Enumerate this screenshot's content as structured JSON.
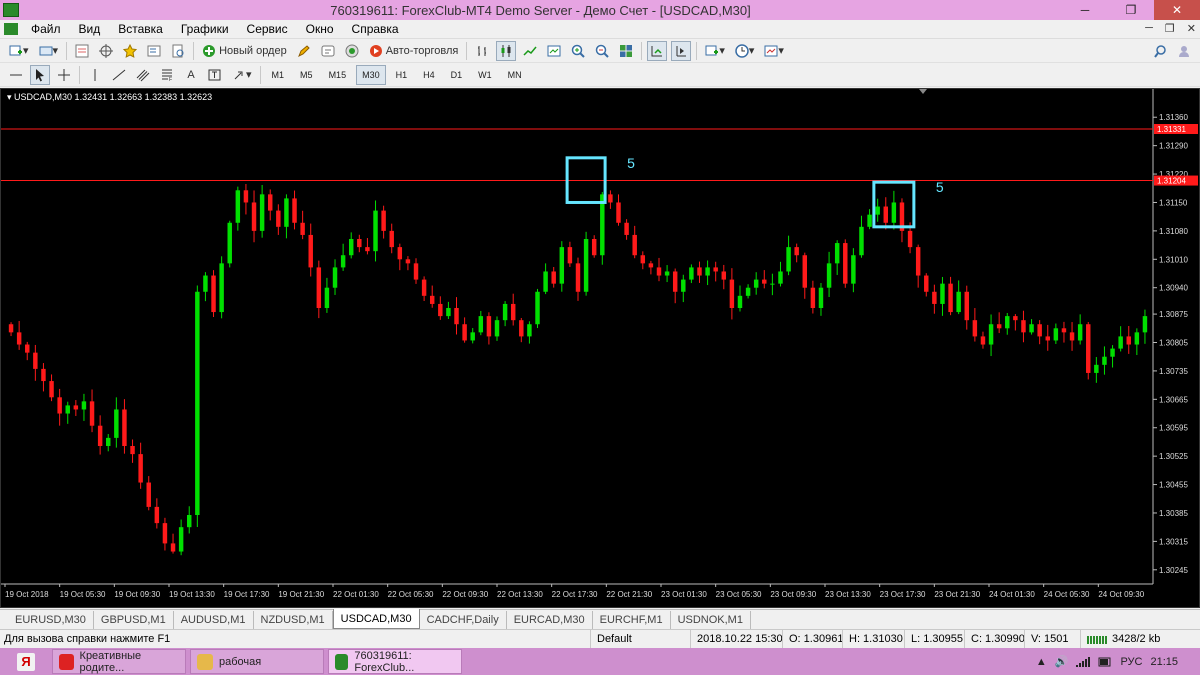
{
  "window": {
    "title": "760319611: ForexClub-MT4 Demo Server - Демо Счет - [USDCAD,M30]",
    "minimize_label": "─",
    "maximize_label": "❐",
    "close_label": "✕"
  },
  "menu": {
    "items": [
      "Файл",
      "Вид",
      "Вставка",
      "Графики",
      "Сервис",
      "Окно",
      "Справка"
    ],
    "mdi_controls": [
      "─",
      "❐",
      "✕"
    ]
  },
  "toolbar1": {
    "new_order_label": "Новый ордер",
    "auto_trading_label": "Авто-торговля"
  },
  "toolbar2": {
    "timeframes": [
      "M1",
      "M5",
      "M15",
      "M30",
      "H1",
      "H4",
      "D1",
      "W1",
      "MN"
    ],
    "active_timeframe": "M30",
    "text_tool_label": "A"
  },
  "chart": {
    "header": "USDCAD,M30  1.32431 1.32663 1.32383 1.32623",
    "background": "#000000",
    "bull_color": "#00e000",
    "bear_color": "#ff1a1a",
    "level_color": "#ff1a1a",
    "box_color": "#66e6ff",
    "annotation_color": "#66e6ff"
  },
  "chart_data": {
    "type": "candlestick",
    "symbol": "USDCAD",
    "timeframe": "M30",
    "ylim": [
      1.3021,
      1.314
    ],
    "y_ticks": [
      "1.31360",
      "1.31290",
      "1.31220",
      "1.31150",
      "1.31080",
      "1.31010",
      "1.30940",
      "1.30875",
      "1.30805",
      "1.30735",
      "1.30665",
      "1.30595",
      "1.30525",
      "1.30455",
      "1.30385",
      "1.30315",
      "1.30245"
    ],
    "x_ticks": [
      "19 Oct 2018",
      "19 Oct 05:30",
      "19 Oct 09:30",
      "19 Oct 13:30",
      "19 Oct 17:30",
      "19 Oct 21:30",
      "22 Oct 01:30",
      "22 Oct 05:30",
      "22 Oct 09:30",
      "22 Oct 13:30",
      "22 Oct 17:30",
      "22 Oct 21:30",
      "23 Oct 01:30",
      "23 Oct 05:30",
      "23 Oct 09:30",
      "23 Oct 13:30",
      "23 Oct 17:30",
      "23 Oct 21:30",
      "24 Oct 01:30",
      "24 Oct 05:30",
      "24 Oct 09:30"
    ],
    "horizontal_levels": [
      {
        "value": 1.31331,
        "label": "1.31331"
      },
      {
        "value": 1.31204,
        "label": "1.31204"
      }
    ],
    "annotations": [
      "5",
      "5"
    ],
    "closes": [
      1.3083,
      1.308,
      1.3078,
      1.3074,
      1.3071,
      1.3067,
      1.3063,
      1.3065,
      1.3064,
      1.3066,
      1.306,
      1.3055,
      1.3057,
      1.3064,
      1.3055,
      1.3053,
      1.3046,
      1.304,
      1.3036,
      1.3031,
      1.3029,
      1.3035,
      1.3038,
      1.3093,
      1.3097,
      1.3088,
      1.31,
      1.311,
      1.3118,
      1.3115,
      1.3108,
      1.3117,
      1.3113,
      1.3109,
      1.3116,
      1.311,
      1.3107,
      1.3099,
      1.3089,
      1.3094,
      1.3099,
      1.3102,
      1.3106,
      1.3104,
      1.3103,
      1.3113,
      1.3108,
      1.3104,
      1.3101,
      1.31,
      1.3096,
      1.3092,
      1.309,
      1.3087,
      1.3089,
      1.3085,
      1.3081,
      1.3083,
      1.3087,
      1.3082,
      1.3086,
      1.309,
      1.3086,
      1.3082,
      1.3085,
      1.3093,
      1.3098,
      1.3095,
      1.3104,
      1.31,
      1.3093,
      1.3106,
      1.3102,
      1.3117,
      1.3115,
      1.311,
      1.3107,
      1.3102,
      1.31,
      1.3099,
      1.3097,
      1.3098,
      1.3093,
      1.3096,
      1.3099,
      1.3097,
      1.3099,
      1.3098,
      1.3096,
      1.3089,
      1.3092,
      1.3094,
      1.3096,
      1.3095,
      1.3095,
      1.3098,
      1.3104,
      1.3102,
      1.3094,
      1.3089,
      1.3094,
      1.31,
      1.3105,
      1.3095,
      1.3102,
      1.3109,
      1.3112,
      1.3114,
      1.311,
      1.3115,
      1.3108,
      1.3104,
      1.3097,
      1.3093,
      1.309,
      1.3095,
      1.3088,
      1.3093,
      1.3086,
      1.3082,
      1.308,
      1.3085,
      1.3084,
      1.3087,
      1.3086,
      1.3083,
      1.3085,
      1.3082,
      1.3081,
      1.3084,
      1.3083,
      1.3081,
      1.3085,
      1.3073,
      1.3075,
      1.3077,
      1.3079,
      1.3082,
      1.308,
      1.3083,
      1.3087
    ],
    "note": "Values read approximately from the chart; open of each candle equals previous close."
  },
  "tabs": [
    "EURUSD,M30",
    "GBPUSD,M1",
    "AUDUSD,M1",
    "NZDUSD,M1",
    "USDCAD,M30",
    "CADCHF,Daily",
    "EURCAD,M30",
    "EURCHF,M1",
    "USDNOK,M1"
  ],
  "active_tab": "USDCAD,M30",
  "status": {
    "hint": "Для вызова справки нажмите F1",
    "profile": "Default",
    "datetime": "2018.10.22 15:30",
    "open": "O: 1.30961",
    "high": "H: 1.31030",
    "low": "L: 1.30955",
    "close": "C: 1.30990",
    "volume": "V: 1501",
    "traffic": "3428/2 kb"
  },
  "taskbar": {
    "start_label": "Я",
    "tasks": [
      "Креативные родите...",
      "рабочая",
      "760319611: ForexClub..."
    ],
    "language": "РУС",
    "clock": "21:15"
  }
}
